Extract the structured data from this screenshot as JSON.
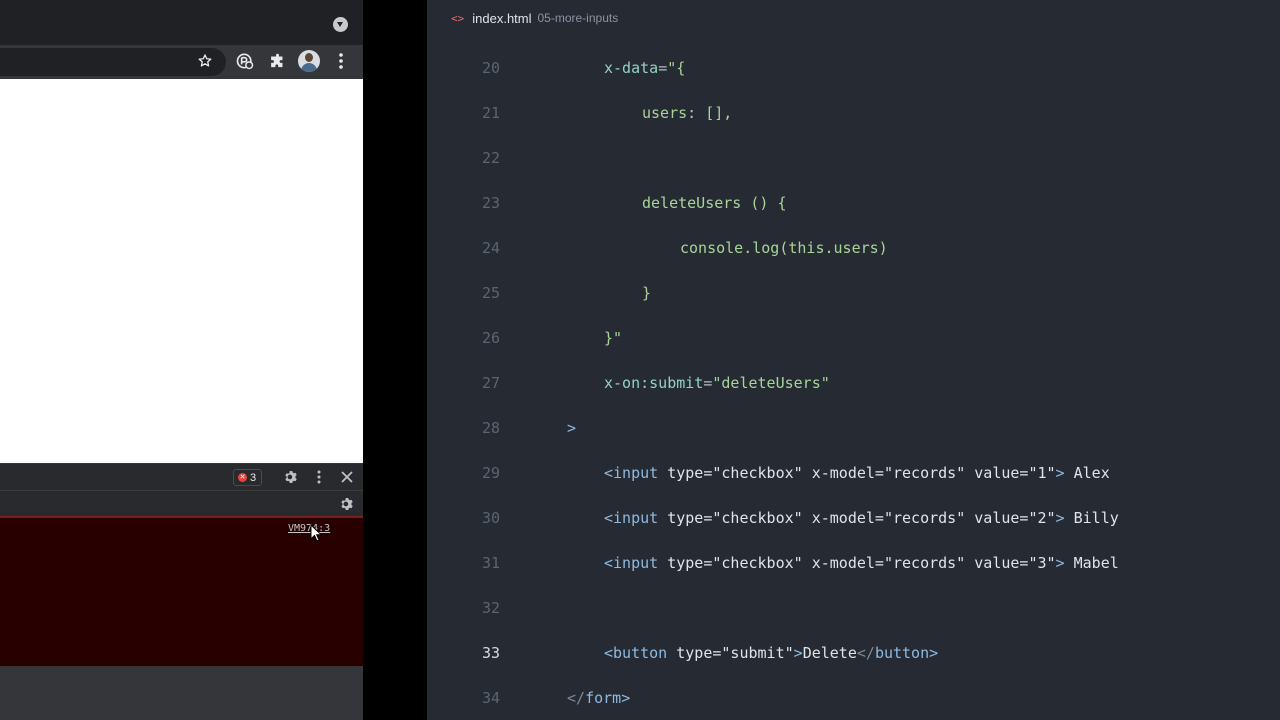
{
  "browser": {
    "console": {
      "error_count": "3",
      "source_link": "VM974:3"
    }
  },
  "editor": {
    "tab": {
      "file_name": "index.html",
      "folder_name": "05-more-inputs"
    },
    "active_line": "33",
    "lines": [
      {
        "n": "20",
        "code": "x-data=\"{"
      },
      {
        "n": "21",
        "code": "users: [],"
      },
      {
        "n": "22",
        "code": ""
      },
      {
        "n": "23",
        "code": "deleteUsers () {"
      },
      {
        "n": "24",
        "code": "console.log(this.users)"
      },
      {
        "n": "25",
        "code": "}"
      },
      {
        "n": "26",
        "code": "}\""
      },
      {
        "n": "27",
        "code": "x-on:submit=\"deleteUsers\""
      },
      {
        "n": "28",
        "code": ">"
      },
      {
        "n": "29",
        "code": "<input type=\"checkbox\" x-model=\"records\" value=\"1\"> Alex"
      },
      {
        "n": "30",
        "code": "<input type=\"checkbox\" x-model=\"records\" value=\"2\"> Billy"
      },
      {
        "n": "31",
        "code": "<input type=\"checkbox\" x-model=\"records\" value=\"3\"> Mabel"
      },
      {
        "n": "32",
        "code": ""
      },
      {
        "n": "33",
        "code": "<button type=\"submit\">Delete</button>"
      },
      {
        "n": "34",
        "code": "</form>"
      }
    ]
  },
  "colors": {
    "editor_bg": "#262b33",
    "console_error_bg": "#290000",
    "browser_chrome": "#35363a"
  },
  "icons": [
    "chevron-down-icon",
    "star-icon",
    "extension-icon",
    "puzzle-icon",
    "avatar",
    "more-vert-icon",
    "error-icon",
    "gear-icon",
    "close-icon",
    "file-code-icon",
    "mouse-cursor-icon"
  ]
}
